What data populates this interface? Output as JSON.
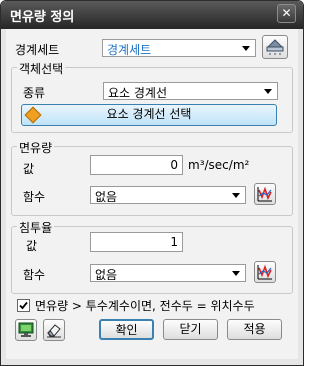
{
  "window": {
    "title": "면유량 정의",
    "close_label": "✕"
  },
  "boundary_set": {
    "label": "경계세트",
    "value": "경계세트"
  },
  "object_select": {
    "legend": "객체선택",
    "type_label": "종류",
    "type_value": "요소 경계선",
    "select_button": "요소 경계선 선택"
  },
  "flux": {
    "legend": "면유량",
    "value_label": "값",
    "value": "0",
    "unit": "m³/sec/m²",
    "function_label": "함수",
    "function_value": "없음"
  },
  "infiltration": {
    "legend": "침투율",
    "value_label": "값",
    "value": "1",
    "function_label": "함수",
    "function_value": "없음"
  },
  "option": {
    "checked": true,
    "text": "면유량 > 투수계수이면, 전수두 = 위치수두"
  },
  "buttons": {
    "ok": "확인",
    "close": "닫기",
    "apply": "적용"
  }
}
